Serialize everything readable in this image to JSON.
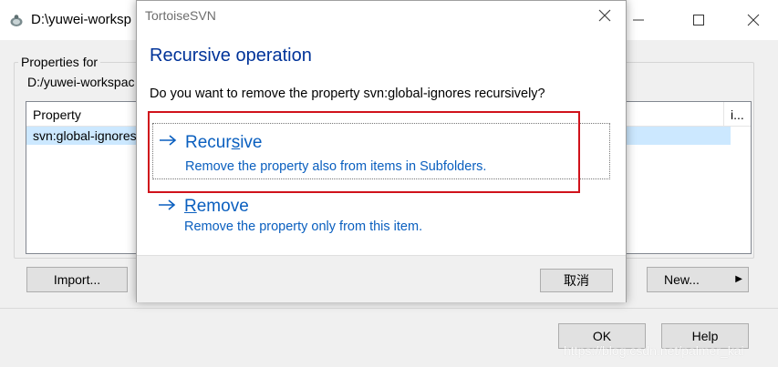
{
  "background_window": {
    "title": "D:\\yuwei-worksp",
    "group_label": "Properties for",
    "path": "D:/yuwei-workspac",
    "list": {
      "columns": [
        "Property",
        "i..."
      ],
      "rows": [
        "svn:global-ignores"
      ]
    },
    "buttons": {
      "import": "Import...",
      "new": "New...",
      "ok": "OK",
      "help": "Help"
    },
    "watermark": "https://blog.csdn.net/palmer_kai"
  },
  "dialog": {
    "title": "TortoiseSVN",
    "heading": "Recursive operation",
    "question": "Do you want to remove the property svn:global-ignores recursively?",
    "options": [
      {
        "title_pre": "Recur",
        "title_u": "s",
        "title_post": "ive",
        "description": "Remove the property also from items in Subfolders."
      },
      {
        "title_pre": "",
        "title_u": "R",
        "title_post": "emove",
        "description": "Remove the property only from this item."
      }
    ],
    "cancel_label": "取消"
  },
  "colors": {
    "link_blue": "#0a5fbf",
    "heading_blue": "#003399",
    "highlight_red": "#d0121b",
    "selection": "#cce8ff"
  }
}
